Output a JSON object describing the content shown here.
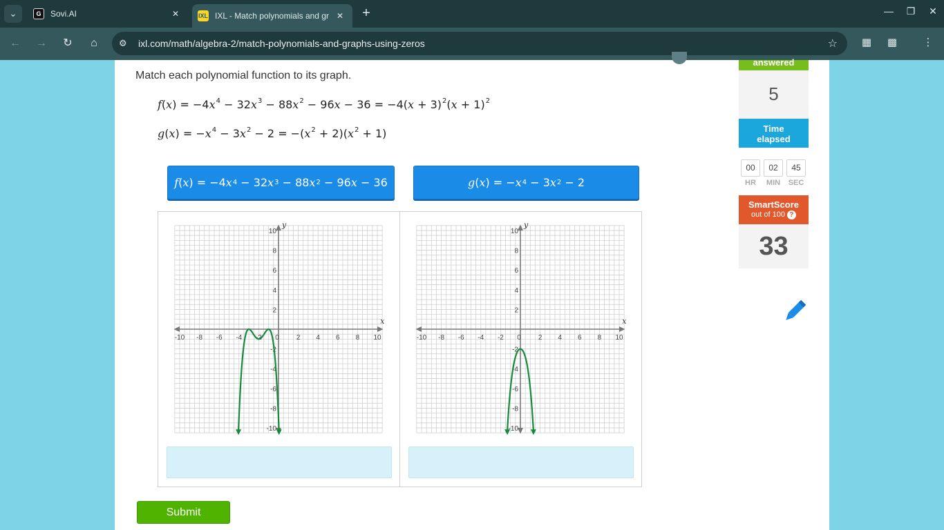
{
  "browser": {
    "tabs": [
      {
        "title": "Sovi.AI",
        "favicon": "G"
      },
      {
        "title": "IXL - Match polynomials and gr",
        "favicon": "IXL"
      }
    ],
    "url": "ixl.com/math/algebra-2/match-polynomials-and-graphs-using-zeros"
  },
  "question": {
    "prompt": "Match each polynomial function to its graph."
  },
  "tiles": [
    "f(x) tile",
    "g(x) tile"
  ],
  "sidebar": {
    "answered_label": "answered",
    "answered_value": "5",
    "time_label_1": "Time",
    "time_label_2": "elapsed",
    "hr": "00",
    "min": "02",
    "sec": "45",
    "hr_label": "HR",
    "min_label": "MIN",
    "sec_label": "SEC",
    "smartscore_label": "SmartScore",
    "smartscore_sub": "out of 100",
    "smartscore_help": "?",
    "smartscore_value": "33"
  },
  "submit_label": "Submit",
  "colors": {
    "tile_blue": "#1a8ce8",
    "submit_green": "#4fb300",
    "curve_green": "#158a3a",
    "answered_green": "#76bd1d",
    "time_blue": "#1ca7dc",
    "smartscore_orange": "#e0582c"
  },
  "graph": {
    "x_label": "x",
    "y_label": "y",
    "x_ticks": [
      "-10",
      "-8",
      "-6",
      "-4",
      "-2",
      "0",
      "2",
      "4",
      "6",
      "8",
      "10"
    ],
    "y_ticks": [
      "10",
      "8",
      "6",
      "4",
      "2",
      "-2",
      "-4",
      "-6",
      "-8",
      "-10"
    ],
    "range": [
      -10,
      10
    ]
  },
  "icons": {
    "dropdown": "chevron-down-icon",
    "pencil": "pencil-icon"
  }
}
